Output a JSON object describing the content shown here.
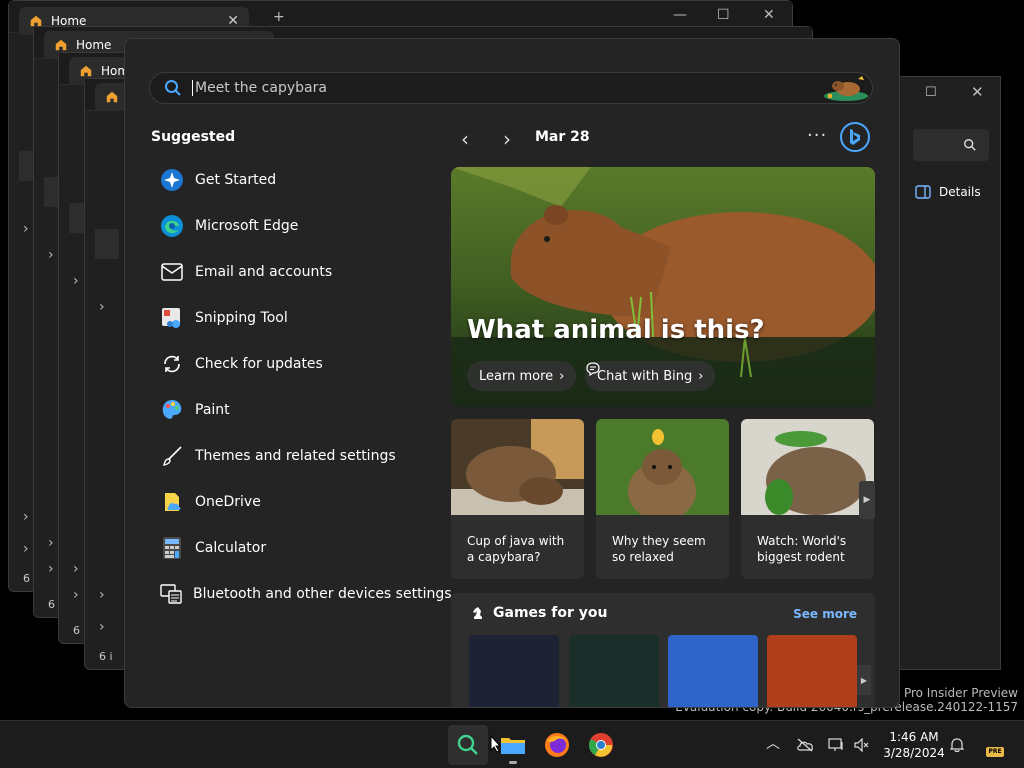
{
  "background_windows": {
    "tab_label": "Home",
    "status_text": "6 i",
    "right_window": {
      "details_label": "Details"
    }
  },
  "watermark": {
    "line1": "11 Pro Insider Preview",
    "line2": "Evaluation copy. Build 26040.rs_prerelease.240122-1157"
  },
  "start_menu": {
    "search": {
      "placeholder": "Meet the capybara",
      "value": ""
    },
    "suggested": {
      "title": "Suggested",
      "items": [
        {
          "label": "Get Started",
          "icon": "get-started-icon"
        },
        {
          "label": "Microsoft Edge",
          "icon": "edge-icon"
        },
        {
          "label": "Email and accounts",
          "icon": "mail-icon"
        },
        {
          "label": "Snipping Tool",
          "icon": "snipping-tool-icon"
        },
        {
          "label": "Check for updates",
          "icon": "refresh-icon"
        },
        {
          "label": "Paint",
          "icon": "paint-icon"
        },
        {
          "label": "Themes and related settings",
          "icon": "brush-icon"
        },
        {
          "label": "OneDrive",
          "icon": "onedrive-icon"
        },
        {
          "label": "Calculator",
          "icon": "calculator-icon"
        },
        {
          "label": "Bluetooth and other devices settings",
          "icon": "devices-icon"
        }
      ]
    },
    "feed": {
      "date": "Mar 28",
      "more_label": "···",
      "hero": {
        "title": "What animal is this?",
        "learn_more": "Learn more",
        "chat_with_bing": "Chat with Bing"
      },
      "cards": [
        {
          "caption": "Cup of java with a capybara?"
        },
        {
          "caption": "Why they seem so relaxed"
        },
        {
          "caption": "Watch: World's biggest rodent"
        }
      ],
      "games": {
        "title": "Games for you",
        "see_more": "See more",
        "tile_colors": [
          "#1e2235",
          "#1c2e2a",
          "#2f64c8",
          "#b0401c"
        ]
      }
    }
  },
  "taskbar": {
    "clock_time": "1:46 AM",
    "clock_date": "3/28/2024",
    "badge": "PRE"
  },
  "colors": {
    "accent_blue": "#7ab8ff",
    "start_bg": "#242424",
    "taskbar_bg": "#1c1c1c"
  }
}
